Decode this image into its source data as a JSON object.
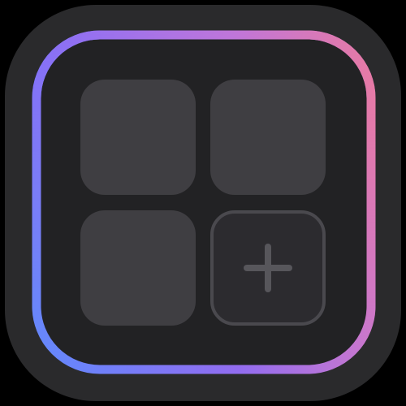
{
  "icon": {
    "name": "widget-grid-app-icon",
    "symbol": "plus-icon",
    "colors": {
      "page_background": "#000000",
      "outer_plate": "#2a2a2c",
      "inner_panel": "#222224",
      "tile": "#3f3e42",
      "add_tile_border": "#4a494e",
      "plus": "#57565b",
      "gradient_start": "#8b6cf7",
      "gradient_mid": "#c477d6",
      "gradient_end": "#f07b97",
      "gradient_bottom": "#5a8cff"
    }
  }
}
